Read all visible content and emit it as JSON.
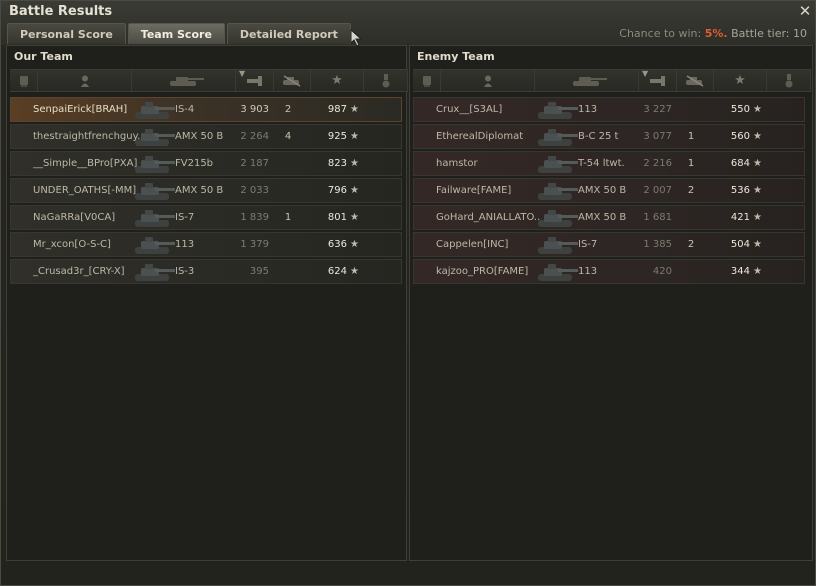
{
  "window": {
    "title": "Battle Results"
  },
  "tabs": [
    {
      "label": "Personal Score",
      "active": false
    },
    {
      "label": "Team Score",
      "active": true
    },
    {
      "label": "Detailed Report",
      "active": false
    }
  ],
  "info": {
    "chance_label": "Chance to win:",
    "chance_value": "5%.",
    "tier_label": "Battle tier:",
    "tier_value": "10"
  },
  "columns": [
    "squad-icon",
    "player-icon",
    "tank-icon",
    "damage-icon",
    "frags-icon",
    "xp-star-icon",
    "medal-icon"
  ],
  "our_team": {
    "title": "Our Team",
    "rows": [
      {
        "player": "SenpaiErick[BRAH]",
        "tank": "IS-4",
        "damage": "3 903",
        "frags": "2",
        "xp": "987",
        "highlight": true
      },
      {
        "player": "thestraightfrenchguy..",
        "tank": "AMX 50 B",
        "damage": "2 264",
        "frags": "4",
        "xp": "925"
      },
      {
        "player": "__Simple__BPro[PXA]",
        "tank": "FV215b",
        "damage": "2 187",
        "frags": "",
        "xp": "823"
      },
      {
        "player": "UNDER_OATHS[-MM]",
        "tank": "AMX 50 B",
        "damage": "2 033",
        "frags": "",
        "xp": "796"
      },
      {
        "player": "NaGaRRa[V0CA]",
        "tank": "IS-7",
        "damage": "1 839",
        "frags": "1",
        "xp": "801"
      },
      {
        "player": "Mr_xcon[O-S-C]",
        "tank": "113",
        "damage": "1 379",
        "frags": "",
        "xp": "636"
      },
      {
        "player": "_Crusad3r_[CRY-X]",
        "tank": "IS-3",
        "damage": "395",
        "frags": "",
        "xp": "624"
      }
    ]
  },
  "enemy_team": {
    "title": "Enemy Team",
    "rows": [
      {
        "player": "Crux__[S3AL]",
        "tank": "113",
        "damage": "3 227",
        "frags": "",
        "xp": "550"
      },
      {
        "player": "EtherealDiplomat",
        "tank": "B-C 25 t",
        "damage": "3 077",
        "frags": "1",
        "xp": "560"
      },
      {
        "player": "hamstor",
        "tank": "T-54 ltwt.",
        "damage": "2 216",
        "frags": "1",
        "xp": "684"
      },
      {
        "player": "Failware[FAME]",
        "tank": "AMX 50 B",
        "damage": "2 007",
        "frags": "2",
        "xp": "536"
      },
      {
        "player": "GoHard_ANIALLATO..",
        "tank": "AMX 50 B",
        "damage": "1 681",
        "frags": "",
        "xp": "421"
      },
      {
        "player": "Cappelen[INC]",
        "tank": "IS-7",
        "damage": "1 385",
        "frags": "2",
        "xp": "504"
      },
      {
        "player": "kajzoo_PRO[FAME]",
        "tank": "113",
        "damage": "420",
        "frags": "",
        "xp": "344"
      }
    ]
  },
  "colors": {
    "accent_pct": "#e05a32",
    "highlight_row": "#5a3e23"
  }
}
